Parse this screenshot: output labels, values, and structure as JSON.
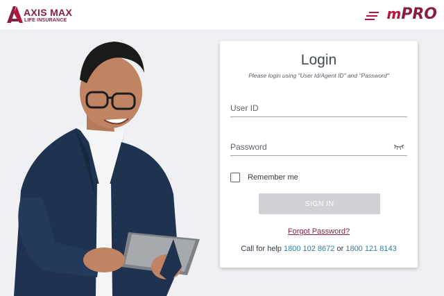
{
  "header": {
    "brand_name": "AXIS MAX",
    "brand_sub": "LIFE INSURANCE",
    "app_logo_prefix": "m",
    "app_logo_main": "PRO"
  },
  "login": {
    "title": "Login",
    "subtitle": "Please login using \"User Id/Agent ID\" and \"Password\"",
    "user_id_placeholder": "User ID",
    "user_id_value": "",
    "password_placeholder": "Password",
    "password_value": "",
    "remember_label": "Remember me",
    "remember_checked": false,
    "signin_label": "SIGN IN",
    "forgot_label": "Forgot Password?",
    "help_prefix": "Call for help",
    "help_phone_1": "1800 102 8672",
    "help_or": "or",
    "help_phone_2": "1800 121 8143"
  },
  "icons": {
    "brand_mark": "axis-max-logo-icon",
    "password_toggle": "eye-closed-icon"
  },
  "colors": {
    "brand": "#861f41",
    "link": "#2a7f9e",
    "button_disabled": "#cfd1d4",
    "background": "#eef0f3"
  }
}
